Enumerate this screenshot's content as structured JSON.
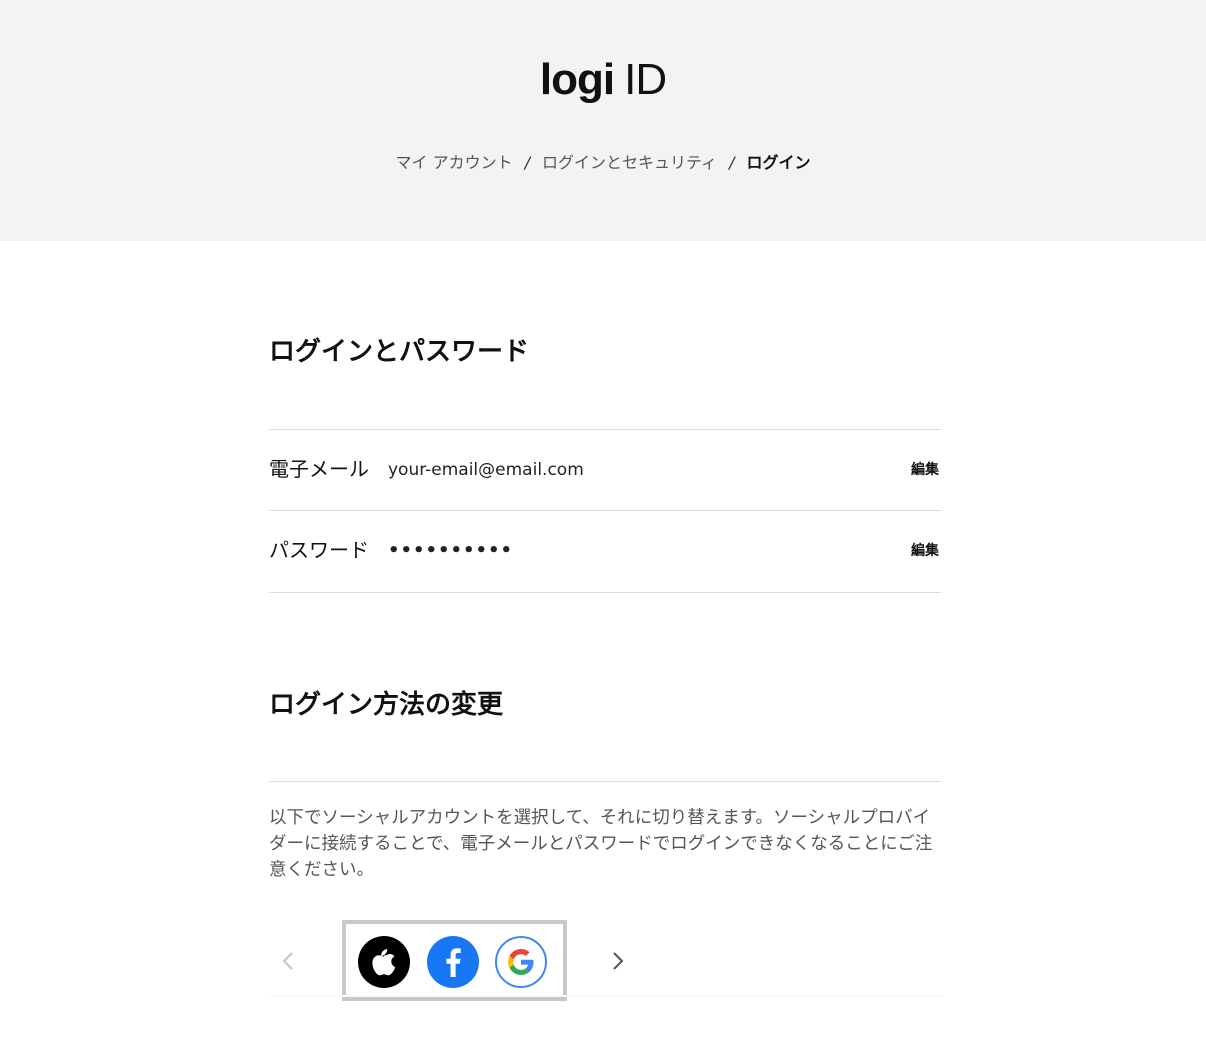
{
  "header": {
    "logo_brand": "logi",
    "logo_suffix": "ID"
  },
  "breadcrumb": {
    "items": [
      "マイ アカウント",
      "ログインとセキュリティ",
      "ログイン"
    ],
    "separator": "/"
  },
  "login_section": {
    "title": "ログインとパスワード",
    "rows": [
      {
        "label": "電子メール",
        "value": "your-email@email.com",
        "action": "編集"
      },
      {
        "label": "パスワード",
        "value": "••••••••••",
        "action": "編集"
      }
    ]
  },
  "method_section": {
    "title": "ログイン方法の変更",
    "description": "以下でソーシャルアカウントを選択して、それに切り替えます。ソーシャルプロバイダーに接続することで、電子メールとパスワードでログインできなくなることにご注意ください。",
    "providers": [
      {
        "name": "apple",
        "icon": "apple-icon",
        "color": "#000000"
      },
      {
        "name": "facebook",
        "icon": "facebook-icon",
        "color": "#1877f2"
      },
      {
        "name": "google",
        "icon": "google-icon",
        "color": "#4285f4"
      }
    ]
  },
  "colors": {
    "header_bg": "#f3f3f3",
    "divider": "#dcdcdc",
    "text_primary": "#111111",
    "text_secondary": "#555555",
    "provider_frame": "#c8c8c8"
  }
}
